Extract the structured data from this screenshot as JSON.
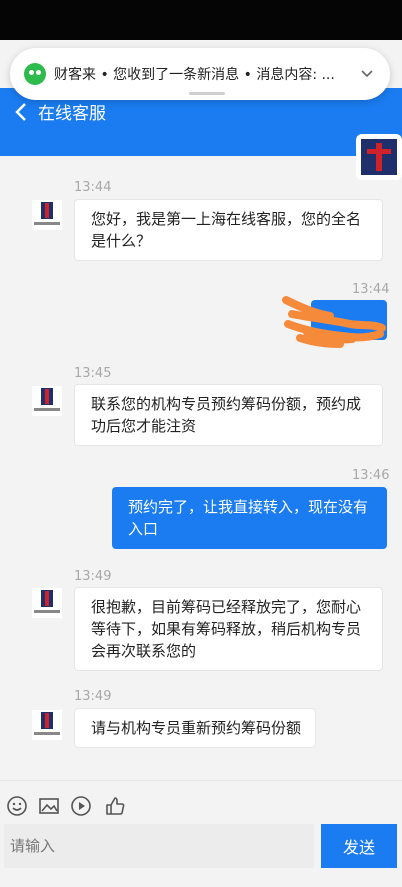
{
  "notification": {
    "text": "财客来 • 您收到了一条新消息 • 消息内容: ..."
  },
  "header": {
    "title": "在线客服"
  },
  "messages": [
    {
      "time": "13:44",
      "text": "您好，我是第一上海在线客服，您的全名是什么？"
    },
    {
      "time": "13:44",
      "text": ""
    },
    {
      "time": "13:45",
      "text": "联系您的机构专员预约筹码份额，预约成功后您才能注资"
    },
    {
      "time": "13:46",
      "text": "预约完了，让我直接转入，现在没有入口"
    },
    {
      "time": "13:49",
      "text": "很抱歉，目前筹码已经释放完了，您耐心等待下，如果有筹码释放，稍后机构专员会再次联系您的"
    },
    {
      "time": "13:49",
      "text": "请与机构专员重新预约筹码份额"
    }
  ],
  "input": {
    "placeholder": "请输入",
    "send_label": "发送"
  },
  "icons": [
    "emoji-icon",
    "image-icon",
    "video-icon",
    "thumbs-up-icon"
  ],
  "colors": {
    "accent": "#1a7cf0",
    "logo_red": "#d0222a",
    "logo_navy": "#1f2f6b",
    "scribble": "#f48a3a"
  }
}
